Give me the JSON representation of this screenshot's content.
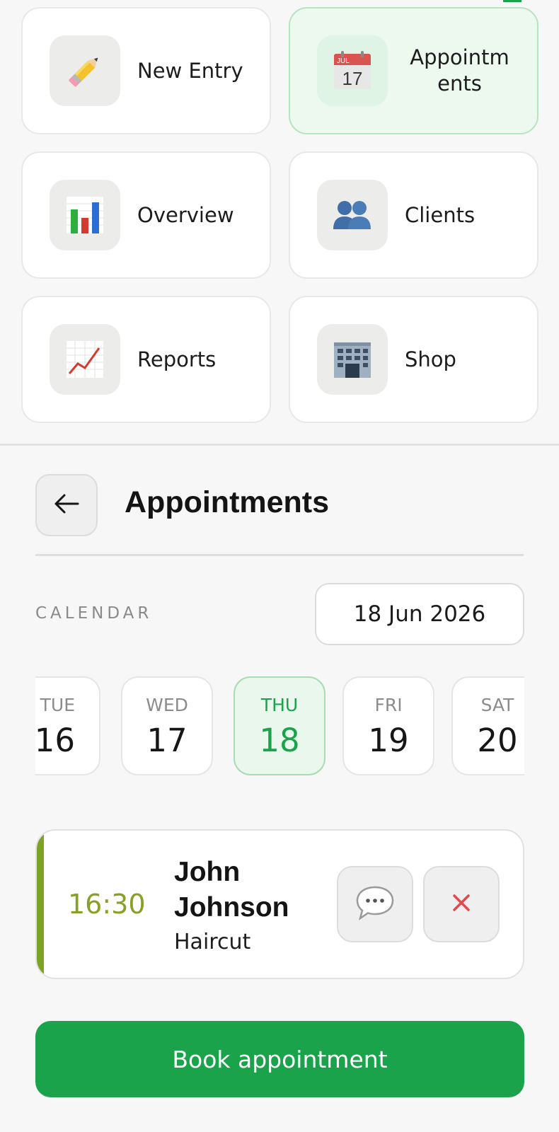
{
  "menu": {
    "items": [
      {
        "label": "New Entry",
        "icon": "pencil-icon"
      },
      {
        "label": "Appointm\nents",
        "icon": "calendar-icon",
        "active": true
      },
      {
        "label": "Overview",
        "icon": "bar-chart-icon"
      },
      {
        "label": "Clients",
        "icon": "people-icon"
      },
      {
        "label": "Reports",
        "icon": "line-chart-icon"
      },
      {
        "label": "Shop",
        "icon": "building-icon"
      }
    ],
    "calendar_icon_month": "JUL",
    "calendar_icon_day": "17"
  },
  "header": {
    "title": "Appointments",
    "back_icon": "arrow-left-icon"
  },
  "calendar": {
    "label": "CALENDAR",
    "selected_date": "18 Jun 2026",
    "days": [
      {
        "dow": "TUE",
        "num": "16"
      },
      {
        "dow": "WED",
        "num": "17"
      },
      {
        "dow": "THU",
        "num": "18",
        "selected": true
      },
      {
        "dow": "FRI",
        "num": "19"
      },
      {
        "dow": "SAT",
        "num": "20"
      }
    ]
  },
  "appointment": {
    "time": "16:30",
    "client": "John Johnson",
    "service": "Haircut",
    "message_icon": "speech-bubble-icon",
    "delete_icon": "close-icon"
  },
  "book_button": {
    "label": "Book appointment"
  },
  "colors": {
    "accent_green": "#1aa34a",
    "time_olive": "#86a028",
    "delete_red": "#e5484d"
  }
}
